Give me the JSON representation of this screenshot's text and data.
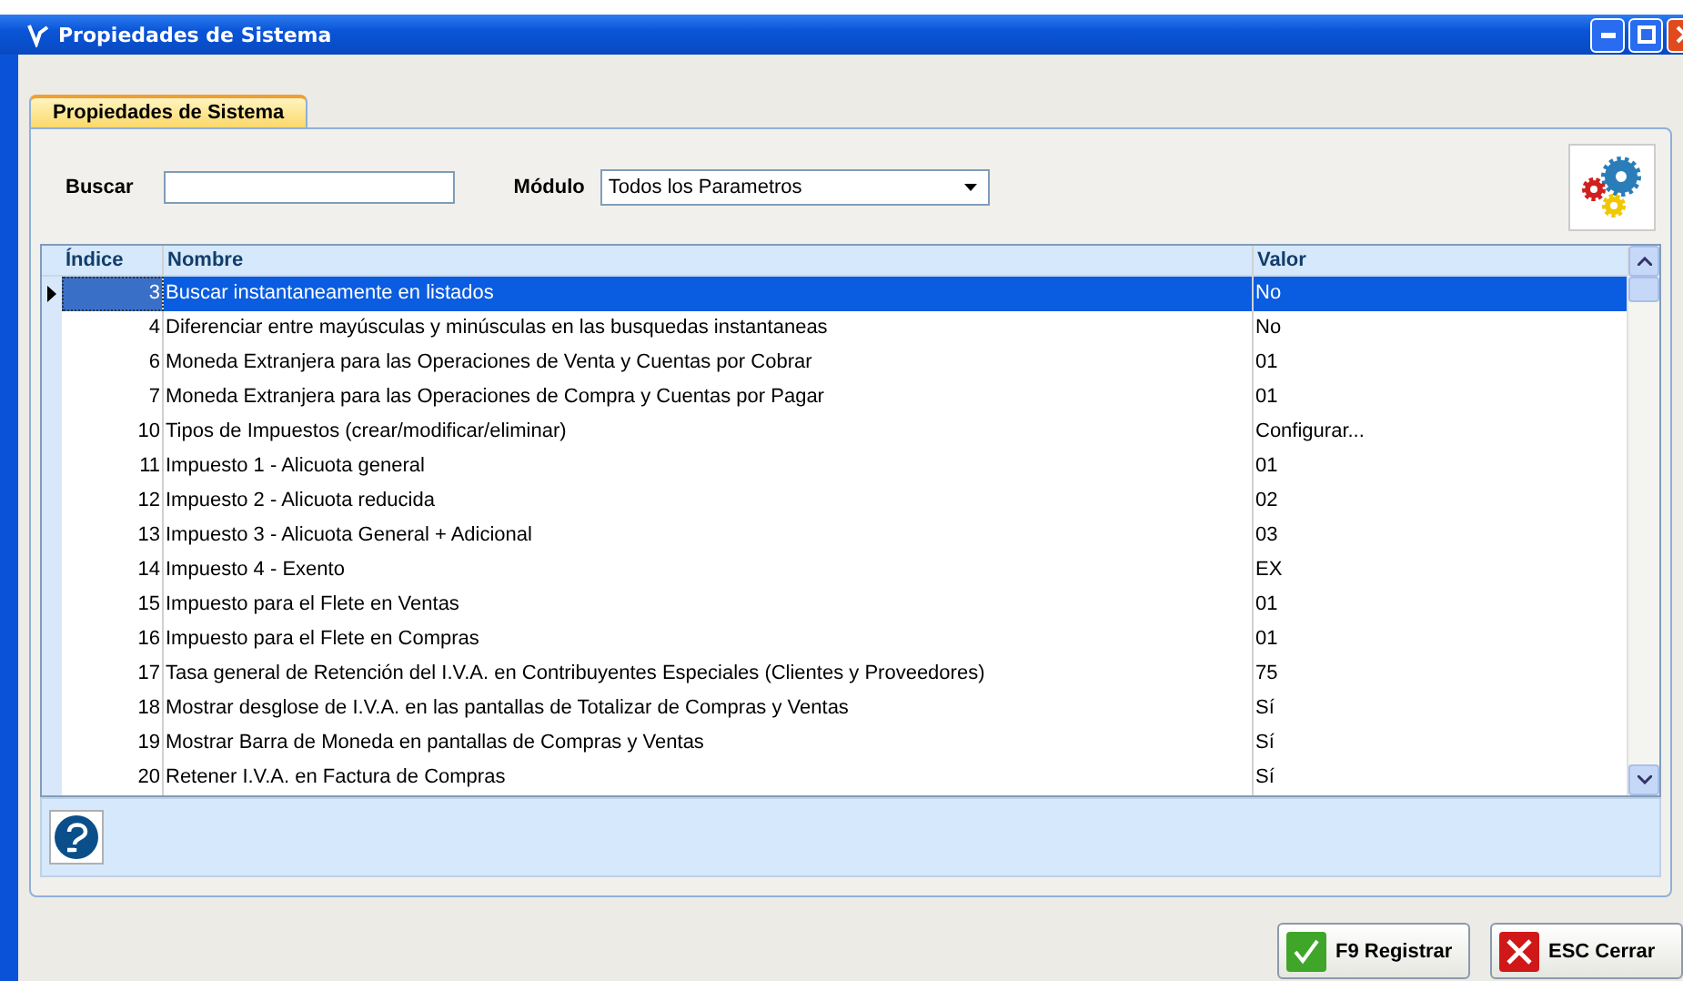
{
  "window": {
    "title": "Propiedades de Sistema"
  },
  "tabs": [
    {
      "label": "Propiedades de Sistema",
      "selected": true
    }
  ],
  "search": {
    "label": "Buscar"
  },
  "module": {
    "label": "Módulo",
    "value": "Todos los Parametros"
  },
  "table": {
    "columns": [
      "Índice",
      "Nombre",
      "Valor"
    ],
    "rows": [
      {
        "index": "3",
        "name": "Buscar instantaneamente en listados",
        "value": "No",
        "selected": true
      },
      {
        "index": "4",
        "name": "Diferenciar entre mayúsculas y minúsculas en las busquedas instantaneas",
        "value": "No",
        "selected": false
      },
      {
        "index": "6",
        "name": "Moneda Extranjera para las Operaciones de Venta y Cuentas por Cobrar",
        "value": "01",
        "selected": false
      },
      {
        "index": "7",
        "name": "Moneda Extranjera para las Operaciones de Compra y Cuentas por Pagar",
        "value": "01",
        "selected": false
      },
      {
        "index": "10",
        "name": "Tipos de Impuestos (crear/modificar/eliminar)",
        "value": "Configurar...",
        "selected": false
      },
      {
        "index": "11",
        "name": "Impuesto 1 - Alicuota general",
        "value": "01",
        "selected": false
      },
      {
        "index": "12",
        "name": "Impuesto 2 - Alicuota reducida",
        "value": "02",
        "selected": false
      },
      {
        "index": "13",
        "name": "Impuesto 3 - Alicuota General + Adicional",
        "value": "03",
        "selected": false
      },
      {
        "index": "14",
        "name": "Impuesto 4 - Exento",
        "value": "EX",
        "selected": false
      },
      {
        "index": "15",
        "name": "Impuesto para el Flete en Ventas",
        "value": "01",
        "selected": false
      },
      {
        "index": "16",
        "name": "Impuesto para el Flete en Compras",
        "value": "01",
        "selected": false
      },
      {
        "index": "17",
        "name": "Tasa general de Retención del I.V.A. en Contribuyentes Especiales (Clientes y Proveedores)",
        "value": "75",
        "selected": false
      },
      {
        "index": "18",
        "name": "Mostrar desglose de I.V.A. en las pantallas de Totalizar de Compras y Ventas",
        "value": "Sí",
        "selected": false
      },
      {
        "index": "19",
        "name": "Mostrar Barra de Moneda en pantallas de Compras y Ventas",
        "value": "Sí",
        "selected": false
      },
      {
        "index": "20",
        "name": "Retener I.V.A. en Factura de Compras",
        "value": "Sí",
        "selected": false
      }
    ]
  },
  "buttons": [
    {
      "kind": "ok",
      "label": "F9 Registrar"
    },
    {
      "kind": "cancel",
      "label": "ESC Cerrar"
    }
  ]
}
